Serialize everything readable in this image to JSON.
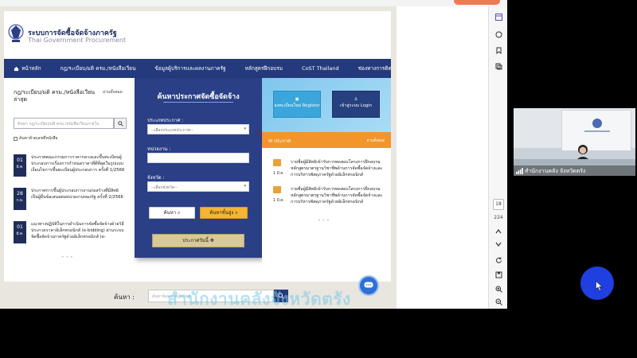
{
  "site": {
    "brand_title": "ระบบการจัดซื้อจัดจ้างภาครัฐ",
    "brand_subtitle": "Thai Government Procurement",
    "nav": [
      {
        "label": "หน้าหลัก"
      },
      {
        "label": "กฎ/ระเบียบ/มติ ครม./หนังสือเวียน"
      },
      {
        "label": "ข้อมูลผู้บริการและผลงานภาครัฐ"
      },
      {
        "label": "หลักสูตรฝึกอบรม"
      },
      {
        "label": "CoST Thailand"
      },
      {
        "label": "ช่องทางการติดต่อ"
      }
    ],
    "left": {
      "heading": "กฎ/ระเบียบ/มติ ครม./หนังสือเวียน ล่าสุด",
      "view_all": "อ่านทั้งหมด",
      "search_placeholder": "ค้นหา กฎ/ระเบียบ/มติ ครม./หนังสือเวียนภายใน",
      "checkbox_label": "ค้นหาด้วยเลขที่หนังสือ",
      "news": [
        {
          "day": "01",
          "month": "มี.ค.",
          "text": "ประกาศคณะกรรมการราคากลางและขึ้นทะเบียนผู้ประกอบการเรื่องการกำหนดราคาที่ดีที่สุดในรูปแบบเงื่อนไขการขึ้นทะเบียนผู้ประกอบการ ครั้งที่ 1/2566"
        },
        {
          "day": "28",
          "month": "ก.พ.",
          "text": "ประกาศการขึ้นผู้ประกอบการงานก่อสร้างที่มีสิทธิเป็นผู้ยื่นข้อเสนอต่อหน่วยงานของรัฐ ครั้งที่ 2/2566"
        },
        {
          "day": "01",
          "month": "มี.ค.",
          "text": "แนวทางปฏิบัติในการดำเนินการจัดซื้อจัดจ้างด้วยวิธีประกวดราคาอิเล็กทรอนิกส์ (e-bidding) ผ่านระบบจัดซื้อจัดจ้างภาครัฐด้วยอิเล็กทรอนิกส์ (e-"
        }
      ]
    },
    "panel": {
      "title": "ค้นหาประกาศจัดซื้อจัดจ้าง",
      "type_label": "ประเภทประกาศ :",
      "type_value": "--เลือกประเภทประกาศ--",
      "agency_label": "หน่วยงาน :",
      "province_label": "จังหวัด :",
      "province_value": "--เลือกจังหวัด--",
      "search_button": "ค้นหา",
      "advanced_button": "ค้นหาขั้นสูง",
      "today_button": "ประกาศวันนี้"
    },
    "right": {
      "register_button": "ลงทะเบียนใหม่ Register",
      "login_button": "เข้าสู่ระบบ Login",
      "announce_title": "ประกาศ",
      "announce_view_all": "อ่านทั้งหมด",
      "announcements": [
        {
          "date": "1 มี.ค.",
          "text": "รายชื่อผู้มีสิทธิเข้ารับการทดสอบโครงการฝึกอบรมหลักสูตรมาตรฐานวิชาชีพด้านการจัดซื้อจัดจ้างและการบริหารพัสดุภาครัฐด้วยอิเล็กทรอนิกส์"
        },
        {
          "date": "1 มี.ค.",
          "text": "รายชื่อผู้มีสิทธิเข้ารับการทดสอบโครงการฝึกอบรมหลักสูตรมาตรฐานวิชาชีพด้านการจัดซื้อจัดจ้างและการบริหารพัสดุภาครัฐด้วยอิเล็กทรอนิกส์"
        }
      ]
    },
    "bottom": {
      "search_label": "ค้นหา :",
      "search_placeholder": "ค้นหาข้อมูลในเว็บไซต์"
    },
    "watermark": "สำนักงานคลังจังหวัดตรัง"
  },
  "sidebar": {
    "page_number": "18",
    "zoom": "224"
  },
  "webcam": {
    "participant_name": "สำนักงานคลัง จังหวัดตรัง"
  },
  "colors": {
    "nav_bg": "#243a7c",
    "panel_bg": "#2a3f86",
    "accent_orange": "#f2962b",
    "advanced_btn": "#f5b431",
    "cursor_highlight": "#1f3fe0"
  }
}
